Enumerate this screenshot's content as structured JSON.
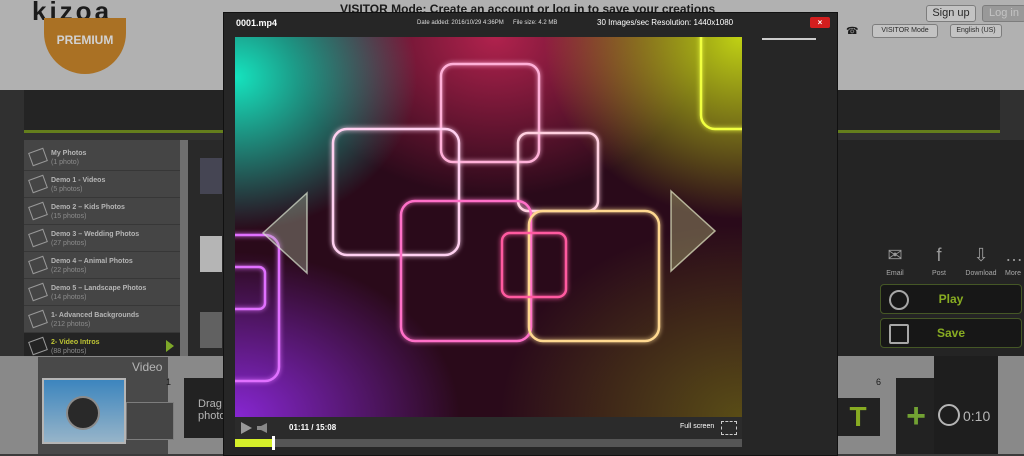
{
  "app": {
    "logo": "kizoa",
    "premium": "PREMIUM",
    "visitor_banner": "VISITOR Mode: Create an account or log in to save your creations",
    "signup": "Sign up",
    "login": "Log in",
    "visitor_mode": "VISITOR Mode",
    "language": "English (US)"
  },
  "sidebar": {
    "items": [
      {
        "title": "My Photos",
        "sub": "(1 photo)"
      },
      {
        "title": "Demo 1 - Videos",
        "sub": "(5 photos)"
      },
      {
        "title": "Demo 2 – Kids Photos",
        "sub": "(15 photos)"
      },
      {
        "title": "Demo 3 – Wedding Photos",
        "sub": "(27 photos)"
      },
      {
        "title": "Demo 4 – Animal Photos",
        "sub": "(22 photos)"
      },
      {
        "title": "Demo 5 – Landscape Photos",
        "sub": "(14 photos)"
      },
      {
        "title": "1- Advanced Backgrounds",
        "sub": "(212 photos)"
      },
      {
        "title": "2- Video Intros",
        "sub": "(88 photos)"
      }
    ]
  },
  "share": {
    "email": "Email",
    "post": "Post",
    "download": "Download",
    "more": "More"
  },
  "actions": {
    "play": "Play",
    "save": "Save"
  },
  "timeline": {
    "video_label": "Video",
    "slot_one": "1",
    "drag_label": "Drag photo",
    "slot_six": "6",
    "text_tool": "T",
    "add": "+",
    "duration": "0:10"
  },
  "modal": {
    "filename": "0001.mp4",
    "date_added": "Date added: 2016/10/29 4:36PM",
    "file_size": "File size: 4.2 MB",
    "resolution": "30 Images/sec Resolution: 1440x1080",
    "close": "×",
    "current_time": "01:11",
    "duration": "15:08",
    "time_separator": "/",
    "fullscreen_label": "Full screen",
    "progress": 0.075
  }
}
